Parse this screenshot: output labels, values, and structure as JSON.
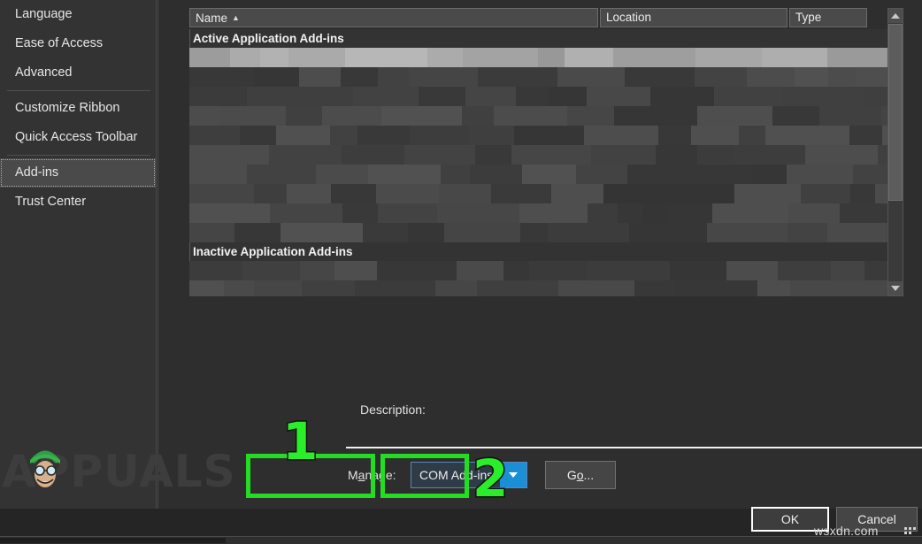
{
  "sidebar": {
    "items": [
      {
        "label": "Language",
        "selected": false,
        "separator_after": false
      },
      {
        "label": "Ease of Access",
        "selected": false,
        "separator_after": false
      },
      {
        "label": "Advanced",
        "selected": false,
        "separator_after": true
      },
      {
        "label": "Customize Ribbon",
        "selected": false,
        "separator_after": false
      },
      {
        "label": "Quick Access Toolbar",
        "selected": false,
        "separator_after": true
      },
      {
        "label": "Add-ins",
        "selected": true,
        "separator_after": false
      },
      {
        "label": "Trust Center",
        "selected": false,
        "separator_after": false
      }
    ]
  },
  "list": {
    "columns": [
      {
        "label": "Name",
        "sort": "ascending",
        "sort_glyph": "▲"
      },
      {
        "label": "Location",
        "sort": "none",
        "sort_glyph": ""
      },
      {
        "label": "Type",
        "sort": "none",
        "sort_glyph": ""
      }
    ],
    "groups": [
      {
        "header": "Active Application Add-ins"
      },
      {
        "header": "Inactive Application Add-ins"
      }
    ],
    "redacted": true
  },
  "scrollbar": {
    "up_icon": "scroll-up-arrow-icon",
    "down_icon": "scroll-down-arrow-icon"
  },
  "description": {
    "label": "Description:",
    "value": ""
  },
  "manage": {
    "label_prefix": "M",
    "label_accel": "a",
    "label_suffix": "nage:",
    "selected_option": "COM Add-ins",
    "dropdown_icon": "chevron-down-icon",
    "go_prefix": "G",
    "go_accel": "o",
    "go_suffix": "..."
  },
  "annotations": [
    {
      "number": "1",
      "target": "manage-combobox"
    },
    {
      "number": "2",
      "target": "go-button"
    }
  ],
  "footer": {
    "ok_label": "OK",
    "cancel_label": "Cancel"
  },
  "watermarks": {
    "brand": "APPUALS",
    "site": "wsxdn.com"
  },
  "colors": {
    "accent_green": "#22dd22",
    "combo_blue": "#1b8fd6",
    "combo_border": "#5b88b8",
    "dialog_bg": "#2e2e2e",
    "sidebar_bg": "#333333",
    "selected_nav": "#4a4a4a"
  }
}
